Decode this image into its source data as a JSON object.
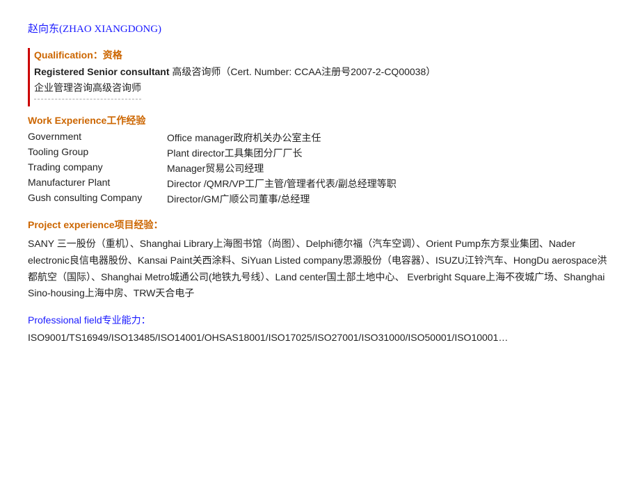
{
  "title": {
    "name": "赵向东(ZHAO  XIANGDONG)"
  },
  "qualification": {
    "label_en": "Qualification",
    "colon": "：",
    "label_cn": "资格",
    "registered_en": "Registered Senior consultant",
    "registered_cn": "高级咨询师（Cert. Number: CCAA注册号2007-2-CQ00038）",
    "enterprise_cn": "企业管理咨询高级咨询师"
  },
  "work_experience": {
    "label_en": "Work Experience",
    "label_cn": "工作经验",
    "entries": [
      {
        "company": "Government",
        "role": "Office manager政府机关办公室主任"
      },
      {
        "company": "Tooling Group",
        "role": "Plant director工具集团分厂厂长"
      },
      {
        "company": "Trading company",
        "role": "Manager贸易公司经理"
      },
      {
        "company": "Manufacturer Plant",
        "role": "Director /QMR/VP工厂主管/管理者代表/副总经理等职"
      },
      {
        "company": "Gush consulting Company",
        "role": "Director/GM广顺公司董事/总经理"
      }
    ]
  },
  "project_experience": {
    "label_en": "Project experience",
    "label_cn": "项目经验",
    "colon": "：",
    "body": "SANY 三一股份（重机）、Shanghai Library上海图书馆（尚图）、Delphi德尔福（汽车空调）、Orient Pump东方泵业集团、Nader electronic良信电器股份、Kansai Paint关西涂料、SiYuan Listed company思源股份（电容器）、ISUZU江铃汽车、HongDu aerospace洪都航空（国际）、Shanghai Metro城通公司(地铁九号线）、Land center国土部土地中心、 Everbright Square上海不夜城广场、Shanghai Sino-housing上海中房、TRW天合电子"
  },
  "professional_field": {
    "label_en": "Professional field",
    "label_cn": "专业能力",
    "colon": "：",
    "body": "ISO9001/TS16949/ISO13485/ISO14001/OHSAS18001/ISO17025/ISO27001/ISO31000/ISO50001/ISO10001…"
  }
}
